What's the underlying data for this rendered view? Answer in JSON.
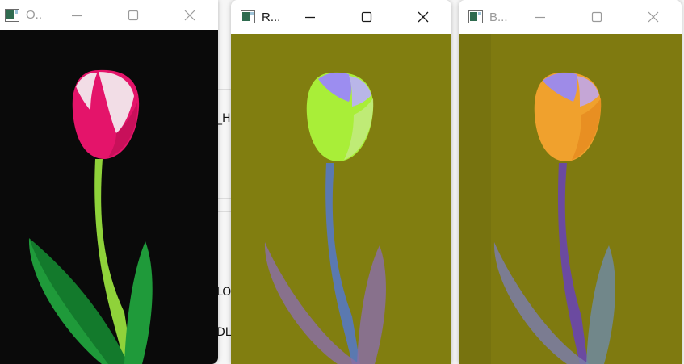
{
  "background": {
    "text_fragments": [
      "_H",
      "LO",
      "DL"
    ]
  },
  "windows": [
    {
      "title": "O..",
      "image": {
        "kind": "tulip-photo",
        "colors": {
          "bg": "#0a0a0a",
          "petal": "#e4146a",
          "petal_light": "#f2dde6",
          "stem": "#8fd23a",
          "leaf": "#1f9a3a"
        }
      }
    },
    {
      "title": "R...",
      "image": {
        "kind": "tulip-color-shifted",
        "colors": {
          "bg": "#817e10",
          "petal": "#a9ee38",
          "petal_top": "#9c8df0",
          "stem": "#5a79b0",
          "leaf": "#8a6fa2"
        }
      }
    },
    {
      "title": "B...",
      "image": {
        "kind": "tulip-color-shifted",
        "colors": {
          "bg": "#7f7a10",
          "petal": "#f0a12d",
          "petal_top": "#9e8be8",
          "stem": "#6b4aa0",
          "leaf": "#7a7ca8"
        }
      }
    }
  ],
  "icons": {
    "app": "window-app-icon",
    "minimize": "minimize-icon",
    "maximize": "maximize-icon",
    "close": "close-icon"
  }
}
